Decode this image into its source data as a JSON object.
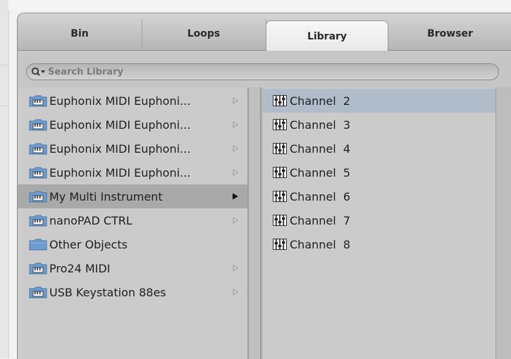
{
  "tabs": [
    {
      "label": "Bin"
    },
    {
      "label": "Loops"
    },
    {
      "label": "Library",
      "active": true
    },
    {
      "label": "Browser"
    }
  ],
  "search": {
    "placeholder": "Search Library"
  },
  "left_list": [
    {
      "label": "Euphonix MIDI Euphoni...",
      "icon": "midi-folder-icon"
    },
    {
      "label": "Euphonix MIDI Euphoni...",
      "icon": "midi-folder-icon"
    },
    {
      "label": "Euphonix MIDI Euphoni...",
      "icon": "midi-folder-icon"
    },
    {
      "label": "Euphonix MIDI Euphoni...",
      "icon": "midi-folder-icon"
    },
    {
      "label": "My Multi Instrument",
      "icon": "midi-folder-icon",
      "selected": true
    },
    {
      "label": "nanoPAD CTRL",
      "icon": "midi-folder-icon"
    },
    {
      "label": "Other Objects",
      "icon": "folder-icon"
    },
    {
      "label": "Pro24 MIDI",
      "icon": "midi-folder-icon"
    },
    {
      "label": "USB Keystation 88es",
      "icon": "midi-folder-icon"
    }
  ],
  "right_list": [
    {
      "label": "Channel  2",
      "selected": true
    },
    {
      "label": "Channel  3"
    },
    {
      "label": "Channel  4"
    },
    {
      "label": "Channel  5"
    },
    {
      "label": "Channel  6"
    },
    {
      "label": "Channel  7"
    },
    {
      "label": "Channel  8"
    }
  ],
  "colors": {
    "selected_left": "#a9a9a9",
    "selected_right": "#b1bcca",
    "folder_blue": "#6f9bd0"
  }
}
